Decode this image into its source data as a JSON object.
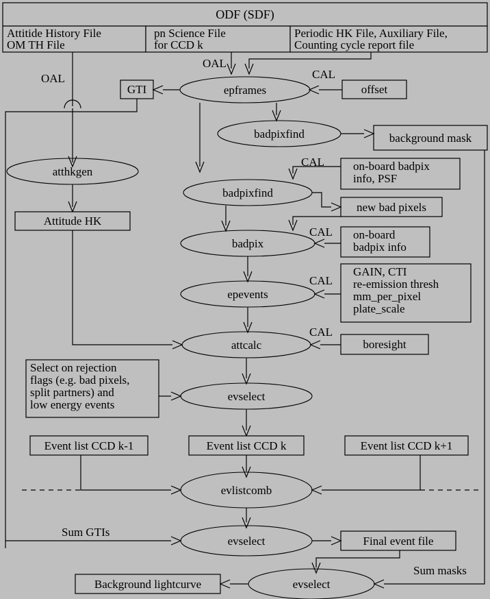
{
  "diagram": {
    "title": "ODF (SDF)",
    "header_cells": [
      {
        "id": "attitude-history-file",
        "lines": [
          "Attitide History File",
          "OM TH File"
        ]
      },
      {
        "id": "pn-science-file",
        "lines": [
          "pn Science File",
          "for CCD k"
        ]
      },
      {
        "id": "periodic-hk-file",
        "lines": [
          "Periodic HK File, Auxiliary File,",
          "Counting cycle report file"
        ]
      }
    ],
    "processes": [
      {
        "id": "epframes",
        "label": "epframes"
      },
      {
        "id": "badpixfind-1",
        "label": "badpixfind"
      },
      {
        "id": "atthkgen",
        "label": "atthkgen"
      },
      {
        "id": "badpixfind-2",
        "label": "badpixfind"
      },
      {
        "id": "badpix",
        "label": "badpix"
      },
      {
        "id": "epevents",
        "label": "epevents"
      },
      {
        "id": "attcalc",
        "label": "attcalc"
      },
      {
        "id": "evselect-1",
        "label": "evselect"
      },
      {
        "id": "evlistcomb",
        "label": "evlistcomb"
      },
      {
        "id": "evselect-2",
        "label": "evselect"
      },
      {
        "id": "evselect-3",
        "label": "evselect"
      }
    ],
    "boxes": [
      {
        "id": "gti",
        "lines": [
          "GTI"
        ]
      },
      {
        "id": "offset",
        "lines": [
          "offset"
        ]
      },
      {
        "id": "background-mask",
        "lines": [
          "background mask"
        ]
      },
      {
        "id": "onboard-badpix-psf",
        "lines": [
          "on-board  badpix",
          "info, PSF"
        ]
      },
      {
        "id": "new-bad-pixels",
        "lines": [
          "new bad pixels"
        ]
      },
      {
        "id": "onboard-badpix-info",
        "lines": [
          "on-board",
          "badpix info"
        ]
      },
      {
        "id": "gain-cti",
        "lines": [
          "GAIN, CTI",
          "re-emission thresh",
          "mm_per_pixel",
          "plate_scale"
        ]
      },
      {
        "id": "boresight",
        "lines": [
          "boresight"
        ]
      },
      {
        "id": "attitude-hk",
        "lines": [
          "Attitude HK"
        ]
      },
      {
        "id": "rejection-flags",
        "lines": [
          "Select on rejection",
          "flags (e.g. bad pixels,",
          "split partners) and",
          "low energy events"
        ]
      },
      {
        "id": "event-list-ccd-km1",
        "lines": [
          "Event list CCD k-1"
        ]
      },
      {
        "id": "event-list-ccd-k",
        "lines": [
          "Event list CCD k"
        ]
      },
      {
        "id": "event-list-ccd-kp1",
        "lines": [
          "Event list CCD k+1"
        ]
      },
      {
        "id": "final-event-file",
        "lines": [
          "Final event file"
        ]
      },
      {
        "id": "background-lightcurve",
        "lines": [
          "Background lightcurve"
        ]
      }
    ],
    "edge_labels": [
      {
        "id": "oal-left",
        "text": "OAL"
      },
      {
        "id": "oal-top",
        "text": "OAL"
      },
      {
        "id": "cal-offset",
        "text": "CAL"
      },
      {
        "id": "cal-badpix-psf",
        "text": "CAL"
      },
      {
        "id": "cal-badpix-info",
        "text": "CAL"
      },
      {
        "id": "cal-gain",
        "text": "CAL"
      },
      {
        "id": "cal-boresight",
        "text": "CAL"
      },
      {
        "id": "sum-gtis",
        "text": "Sum GTIs"
      },
      {
        "id": "sum-masks",
        "text": "Sum masks"
      }
    ],
    "colors": {
      "background": "#bfbfbf",
      "stroke": "#000000",
      "text": "#000000"
    }
  }
}
